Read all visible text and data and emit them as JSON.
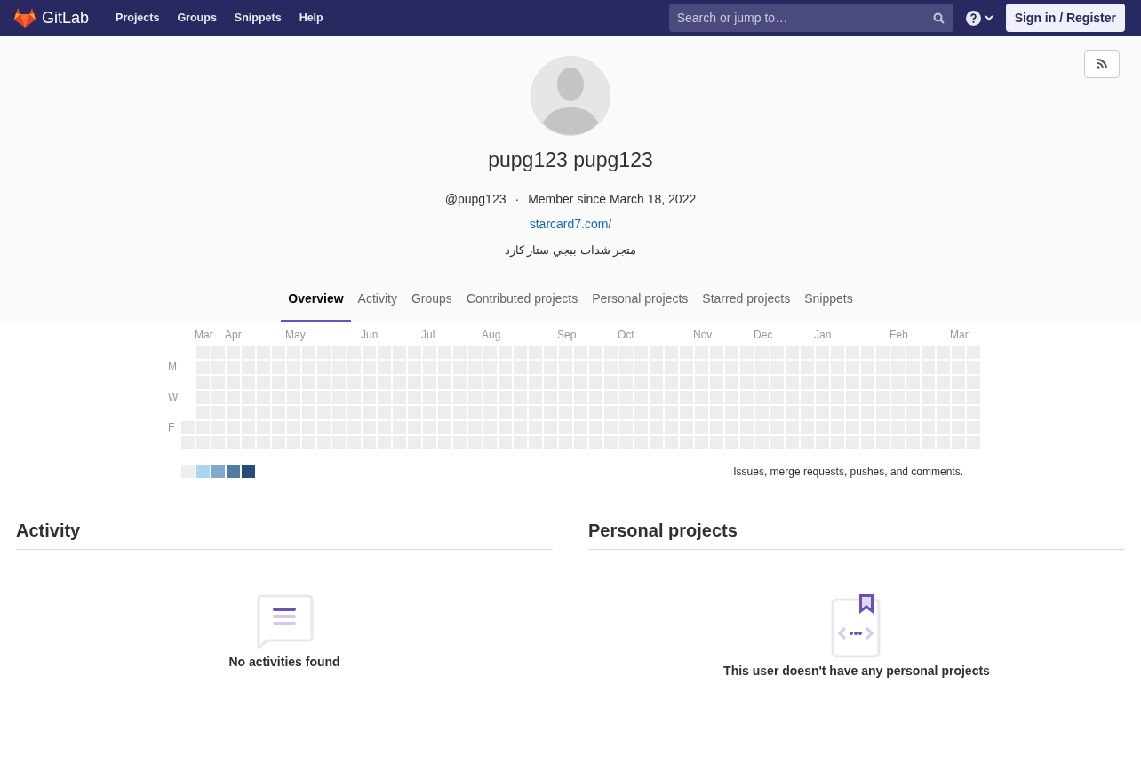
{
  "navbar": {
    "brand": "GitLab",
    "links": [
      "Projects",
      "Groups",
      "Snippets",
      "Help"
    ],
    "search": {
      "placeholder": "Search or jump to…"
    },
    "sign_in": "Sign in / Register"
  },
  "profile": {
    "name": "pupg123 pupg123",
    "username": "@pupg123",
    "separator": "·",
    "member_since": "Member since March 18, 2022",
    "website": "starcard7.com/",
    "bio": "متجر شدات ببجي ستار كارد"
  },
  "tabs": [
    {
      "label": "Overview",
      "selected": true
    },
    {
      "label": "Activity",
      "selected": false
    },
    {
      "label": "Groups",
      "selected": false
    },
    {
      "label": "Contributed projects",
      "selected": false
    },
    {
      "label": "Personal projects",
      "selected": false
    },
    {
      "label": "Starred projects",
      "selected": false
    },
    {
      "label": "Snippets",
      "selected": false
    }
  ],
  "calendar": {
    "months": [
      "Mar",
      "Apr",
      "May",
      "Jun",
      "Jul",
      "Aug",
      "Sep",
      "Oct",
      "Nov",
      "Dec",
      "Jan",
      "Feb",
      "Mar"
    ],
    "day_labels": [
      "M",
      "W",
      "F"
    ],
    "legend": [
      {
        "color": "#ededed"
      },
      {
        "color": "#acd5f2"
      },
      {
        "color": "#7fa8c9"
      },
      {
        "color": "#527ba0"
      },
      {
        "color": "#254e77"
      }
    ],
    "caption": "Issues, merge requests, pushes, and comments."
  },
  "sections": [
    {
      "kind": "activity",
      "title": "Activity",
      "empty_text": "No activities found"
    },
    {
      "kind": "projects",
      "title": "Personal projects",
      "empty_text": "This user doesn't have any personal projects"
    }
  ]
}
